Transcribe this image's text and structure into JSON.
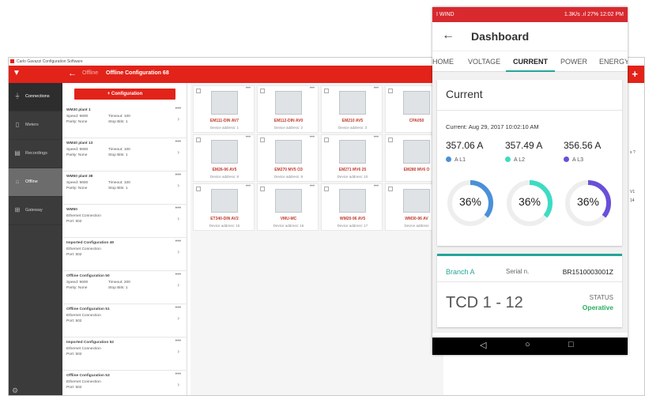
{
  "desktop": {
    "window_title": "Carlo Gavazzi Configuration Software",
    "crumb": "Offline",
    "config_name": "Offline Configuration 68",
    "sidebar": [
      {
        "label": "Connections",
        "icon": "plug-icon"
      },
      {
        "label": "Meters",
        "icon": "meter-icon"
      },
      {
        "label": "Recordings",
        "icon": "recordings-icon"
      },
      {
        "label": "Offline",
        "icon": "offline-icon"
      },
      {
        "label": "Gateway",
        "icon": "gateway-icon"
      }
    ],
    "add_button": "+ Configuration",
    "list": [
      {
        "title": "WM30 plant 1",
        "a": "Speed: 9600",
        "b": "Timeout: 100",
        "c": "Parity: None",
        "d": "Stop Bits: 1"
      },
      {
        "title": "WM40 plant 13",
        "a": "Speed: 9600",
        "b": "Timeout: 100",
        "c": "Parity: None",
        "d": "Stop Bits: 1"
      },
      {
        "title": "WM50 plant 38",
        "a": "Speed: 9600",
        "b": "Timeout: 100",
        "c": "Parity: None",
        "d": "Stop Bits: 1"
      },
      {
        "title": "WM50",
        "a": "Ethernet Connection",
        "b": "",
        "c": "Port: 502",
        "d": ""
      },
      {
        "title": "Imported Configuration 49",
        "a": "Ethernet Connection",
        "b": "",
        "c": "Port: 502",
        "d": ""
      },
      {
        "title": "Offline Configuration 50",
        "a": "Speed: 9600",
        "b": "Timeout: 200",
        "c": "Parity: None",
        "d": "Stop Bits: 1"
      },
      {
        "title": "Offline Configuration 51",
        "a": "Ethernet Connection",
        "b": "",
        "c": "Port: 502",
        "d": ""
      },
      {
        "title": "Imported Configuration 52",
        "a": "Ethernet Connection",
        "b": "",
        "c": "Port: 502",
        "d": ""
      },
      {
        "title": "Offline Configuration 53",
        "a": "Ethernet Connection",
        "b": "",
        "c": "Port: 502",
        "d": ""
      }
    ],
    "devices": [
      {
        "name": "EM111-DIN AV7",
        "addr": "Device address: 1"
      },
      {
        "name": "EM112-DIN AV0",
        "addr": "Device address: 2"
      },
      {
        "name": "EM210 AV5",
        "addr": "Device address: 3"
      },
      {
        "name": "CPA050",
        "addr": ""
      },
      {
        "name": "EM26-96 AV5",
        "addr": "Device address: 8"
      },
      {
        "name": "EM270 MV5 O3",
        "addr": "Device address: 9"
      },
      {
        "name": "EM271 MV6 25",
        "addr": "Device address: 10"
      },
      {
        "name": "EM280 MV6 O",
        "addr": ""
      },
      {
        "name": "ET340-DIN AV2",
        "addr": "Device address: 15"
      },
      {
        "name": "VMU-MC",
        "addr": "Device address: 16"
      },
      {
        "name": "WM20-96 AV5",
        "addr": "Device address: 17"
      },
      {
        "name": "WM30-96 AV",
        "addr": "Device address"
      }
    ],
    "right_stub": [
      "s ?",
      "V1",
      "14"
    ]
  },
  "phone": {
    "status_left": "I WIND",
    "status_right": "1.3K/s  .ıl 27%  12:02 PM",
    "title": "Dashboard",
    "tabs": [
      "HOME",
      "VOLTAGE",
      "CURRENT",
      "POWER",
      "ENERGY"
    ],
    "active_tab": "CURRENT",
    "card_title": "Current",
    "date": "Current: Aug 29, 2017 10:02:10 AM",
    "phases": [
      {
        "value": "357.06 A",
        "label": "A L1",
        "color": "#4a90d9",
        "pct_label": "36%",
        "pct": 0.36
      },
      {
        "value": "357.49 A",
        "label": "A L2",
        "color": "#3ddbc4",
        "pct_label": "36%",
        "pct": 0.36
      },
      {
        "value": "356.56 A",
        "label": "A L3",
        "color": "#6a4fd8",
        "pct_label": "36%",
        "pct": 0.36
      }
    ],
    "branch": "Branch A",
    "serial_label": "Serial n.",
    "serial": "BR1510003001Z",
    "tcd": "TCD 1 - 12",
    "status_label": "STATUS",
    "status_value": "Operative"
  }
}
